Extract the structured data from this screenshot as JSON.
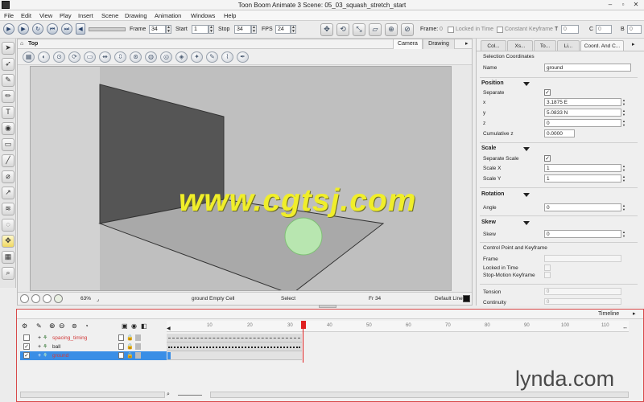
{
  "window": {
    "title": "Toon Boom Animate 3 Scene: 05_03_squash_stretch_start"
  },
  "menu": [
    "File",
    "Edit",
    "View",
    "Play",
    "Insert",
    "Scene",
    "Drawing",
    "Animation",
    "Windows",
    "Help"
  ],
  "playback": {
    "frame_label": "Frame",
    "frame_value": "34",
    "start_label": "Start",
    "start_value": "1",
    "stop_label": "Stop",
    "stop_value": "34",
    "fps_label": "FPS",
    "fps_value": "24",
    "frame2_label": "Frame:",
    "frame2_value": "0",
    "locked_in_time": "Locked in Time",
    "constant_keyframe": "Constant Keyframe",
    "t_label": "T",
    "t_value": "0",
    "c_label": "C",
    "c_value": "0",
    "b_label": "B",
    "b_value": "0"
  },
  "view": {
    "view_name": "Top",
    "tabs": [
      "Camera",
      "Drawing"
    ],
    "zoom": "63%",
    "cell_info": "ground Empty Cell",
    "tool_status": "Select",
    "frame_status": "Fr 34",
    "line_color_label": "Default Line"
  },
  "properties": {
    "tabs": [
      "Col...",
      "Xs...",
      "To...",
      "Li...",
      "Coord. And C..."
    ],
    "header": "Selection Coordinates",
    "name_label": "Name",
    "name_value": "ground",
    "position_title": "Position",
    "separate_label": "Separate",
    "x_label": "x",
    "x_value": "3.1875 E",
    "y_label": "y",
    "y_value": "5.0833 N",
    "z_label": "z",
    "z_value": "0",
    "cumz_label": "Cumulative z",
    "cumz_value": "0.0000",
    "scale_title": "Scale",
    "separate_scale_label": "Separate Scale",
    "scalex_label": "Scale X",
    "scalex_value": "1",
    "scaley_label": "Scale Y",
    "scaley_value": "1",
    "rotation_title": "Rotation",
    "angle_label": "Angle",
    "angle_value": "0",
    "skew_title": "Skew",
    "skew_label": "Skew",
    "skew_value": "0",
    "cp_title": "Control Point and Keyframe",
    "cp_frame_label": "Frame",
    "cp_locked_label": "Locked in Time",
    "cp_stopmotion_label": "Stop-Motion Keyframe",
    "tension_label": "Tension",
    "tension_value": "0",
    "continuity_label": "Continuity",
    "continuity_value": "0"
  },
  "timeline": {
    "title": "Timeline",
    "layers": [
      {
        "name": "spacing_timing",
        "checked": "",
        "color": "#d23a3a"
      },
      {
        "name": "ball",
        "checked": "✓",
        "color": "#222222"
      },
      {
        "name": "ground",
        "checked": "✓",
        "color": "#d23a3a"
      }
    ],
    "ruler_ticks": [
      "10",
      "20",
      "30",
      "40",
      "50",
      "60",
      "70",
      "80",
      "90",
      "100",
      "110"
    ]
  },
  "watermark": "www.cgtsj.com",
  "brand": "lynda.com",
  "colors": {
    "accent_red": "#d84a4a",
    "selection_blue": "#3a8ee6",
    "ball_green": "#b8e6b0"
  }
}
